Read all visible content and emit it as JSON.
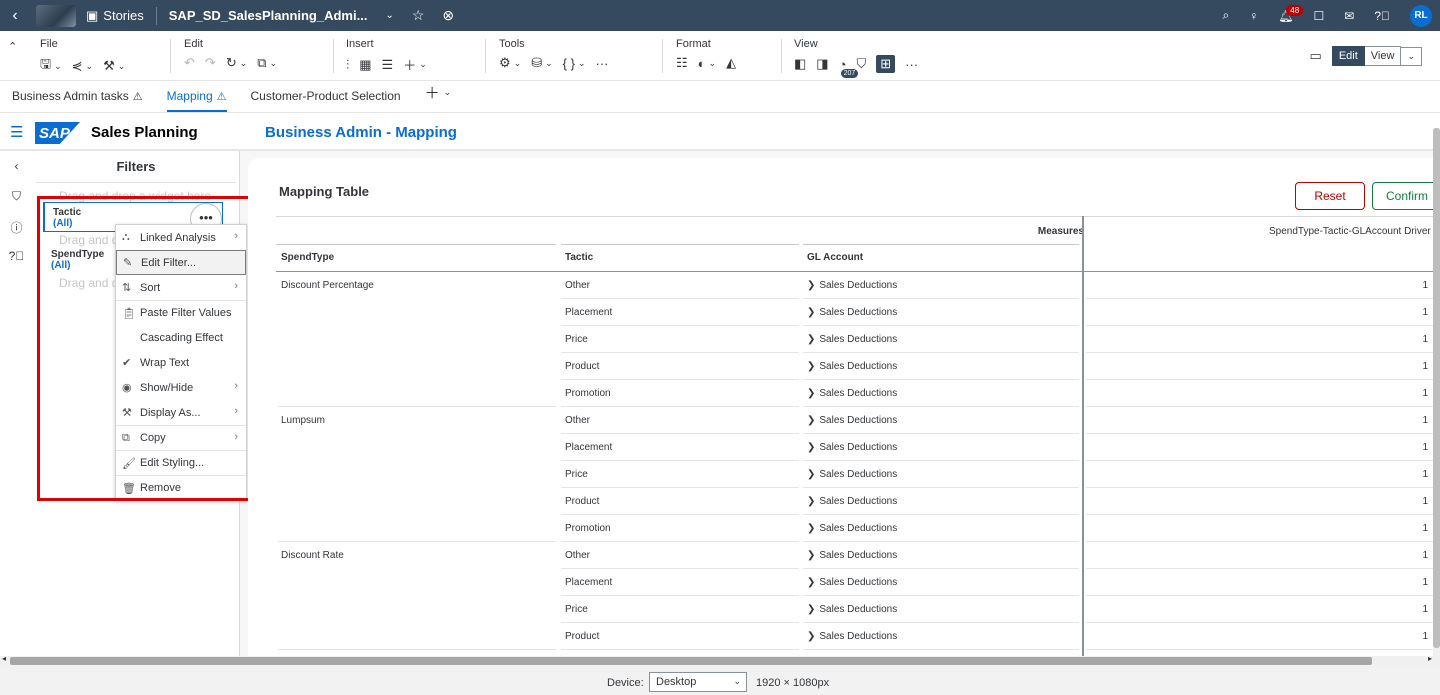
{
  "shell": {
    "stories_label": "Stories",
    "title": "SAP_SD_SalesPlanning_Admi...",
    "notification_count": "48",
    "user_initials": "RL"
  },
  "toolbar": {
    "groups": {
      "file": "File",
      "edit": "Edit",
      "insert": "Insert",
      "tools": "Tools",
      "format": "Format",
      "view": "View"
    },
    "view_badge": "207",
    "mode_edit": "Edit",
    "mode_view": "View"
  },
  "page_tabs": [
    {
      "label": "Business Admin tasks",
      "warning": true
    },
    {
      "label": "Mapping",
      "warning": true,
      "active": true
    },
    {
      "label": "Customer-Product Selection",
      "warning": false
    }
  ],
  "story": {
    "logo_text": "SAP",
    "app_name": "Sales Planning",
    "page_title": "Business Admin - Mapping"
  },
  "filters": {
    "title": "Filters",
    "drop_hint": "Drag and drop a widget here",
    "items": [
      {
        "name": "Tactic",
        "value": "(All)"
      },
      {
        "name": "SpendType",
        "value": "(All)"
      }
    ],
    "more_button": "•••"
  },
  "context_menu": [
    {
      "label": "Linked Analysis",
      "icon": "linked-analysis-icon",
      "submenu": true
    },
    {
      "label": "Edit Filter...",
      "icon": "pencil-icon",
      "submenu": false,
      "highlighted": true
    },
    {
      "label": "Sort",
      "icon": "sort-icon",
      "submenu": true
    },
    {
      "label": "Paste Filter Values",
      "icon": "paste-icon",
      "submenu": false
    },
    {
      "label": "Cascading Effect",
      "icon": "",
      "submenu": false
    },
    {
      "label": "Wrap Text",
      "icon": "checkmark-icon",
      "submenu": false
    },
    {
      "label": "Show/Hide",
      "icon": "eye-icon",
      "submenu": true
    },
    {
      "label": "Display As...",
      "icon": "display-as-icon",
      "submenu": true
    },
    {
      "label": "Copy",
      "icon": "copy-icon",
      "submenu": true
    },
    {
      "label": "Edit Styling...",
      "icon": "styling-icon",
      "submenu": false
    },
    {
      "label": "Remove",
      "icon": "trash-icon",
      "submenu": false
    }
  ],
  "mapping_table": {
    "title": "Mapping Table",
    "reset_label": "Reset",
    "confirm_label": "Confirm",
    "measures_header": "Measures",
    "driver_header": "SpendType-Tactic-GLAccount Driver",
    "columns": [
      "SpendType",
      "Tactic",
      "GL Account"
    ],
    "rows": [
      {
        "spendtype": "Discount Percentage",
        "tactic": "Other",
        "gl": "Sales Deductions",
        "value": "1"
      },
      {
        "spendtype": "",
        "tactic": "Placement",
        "gl": "Sales Deductions",
        "value": "1"
      },
      {
        "spendtype": "",
        "tactic": "Price",
        "gl": "Sales Deductions",
        "value": "1"
      },
      {
        "spendtype": "",
        "tactic": "Product",
        "gl": "Sales Deductions",
        "value": "1"
      },
      {
        "spendtype": "",
        "tactic": "Promotion",
        "gl": "Sales Deductions",
        "value": "1"
      },
      {
        "spendtype": "Lumpsum",
        "tactic": "Other",
        "gl": "Sales Deductions",
        "value": "1"
      },
      {
        "spendtype": "",
        "tactic": "Placement",
        "gl": "Sales Deductions",
        "value": "1"
      },
      {
        "spendtype": "",
        "tactic": "Price",
        "gl": "Sales Deductions",
        "value": "1"
      },
      {
        "spendtype": "",
        "tactic": "Product",
        "gl": "Sales Deductions",
        "value": "1"
      },
      {
        "spendtype": "",
        "tactic": "Promotion",
        "gl": "Sales Deductions",
        "value": "1"
      },
      {
        "spendtype": "Discount Rate",
        "tactic": "Other",
        "gl": "Sales Deductions",
        "value": "1"
      },
      {
        "spendtype": "",
        "tactic": "Placement",
        "gl": "Sales Deductions",
        "value": "1"
      },
      {
        "spendtype": "",
        "tactic": "Price",
        "gl": "Sales Deductions",
        "value": "1"
      },
      {
        "spendtype": "",
        "tactic": "Product",
        "gl": "Sales Deductions",
        "value": "1"
      }
    ]
  },
  "footer": {
    "device_label": "Device:",
    "device_value": "Desktop",
    "resolution": "1920 × 1080px"
  },
  "colors": {
    "shell_bg": "#354a5f",
    "accent": "#0a6ed1",
    "reset": "#bb0000",
    "confirm": "#107e3e",
    "highlight_box": "#e00000"
  }
}
